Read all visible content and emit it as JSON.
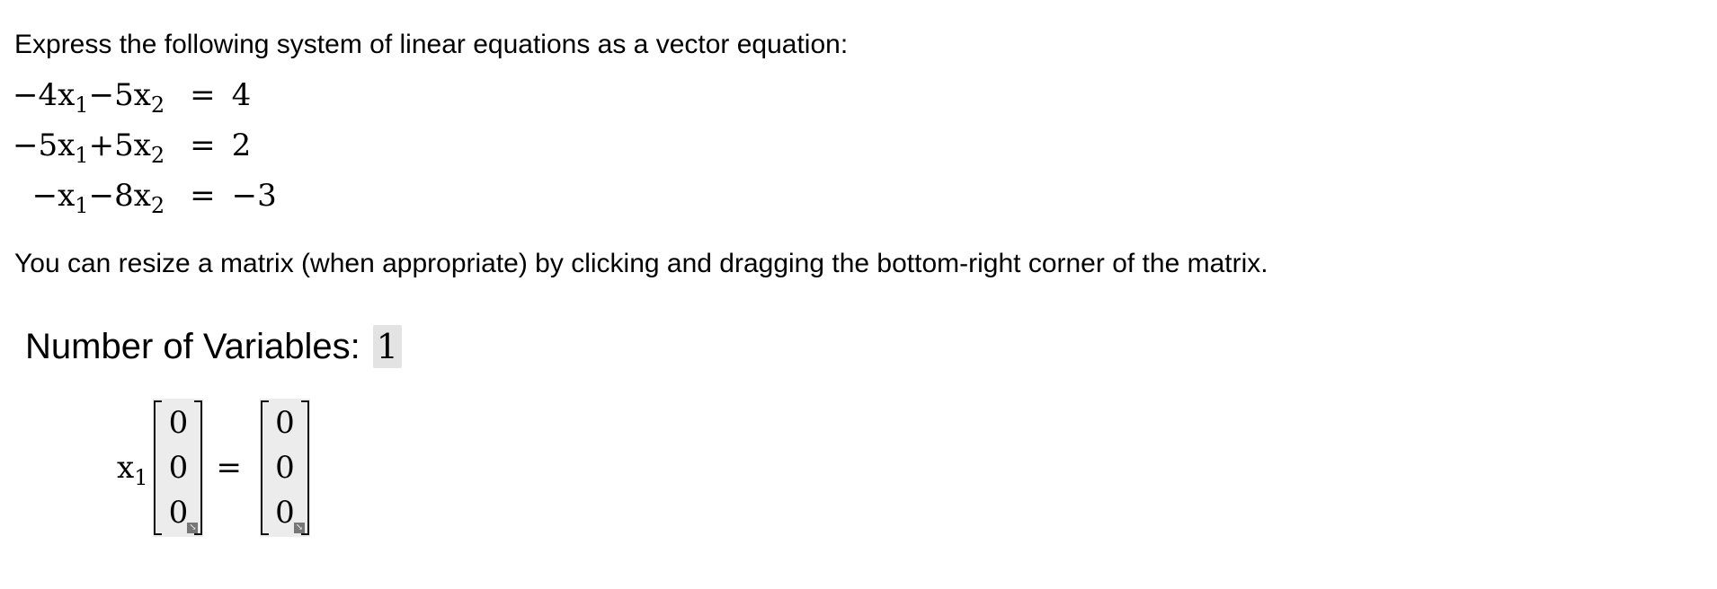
{
  "instructions": "Express the following system of linear equations as a vector equation:",
  "system": [
    {
      "terms": [
        {
          "text": "−4x",
          "sub": "1"
        },
        {
          "text": "−5x",
          "sub": "2"
        }
      ],
      "equals": "=",
      "rhs": "4"
    },
    {
      "terms": [
        {
          "text": "−5x",
          "sub": "1"
        },
        {
          "text": "+5x",
          "sub": "2"
        }
      ],
      "equals": "=",
      "rhs": "2"
    },
    {
      "terms": [
        {
          "text": "−x",
          "sub": "1"
        },
        {
          "text": "−8x",
          "sub": "2"
        }
      ],
      "equals": "=",
      "rhs": "−3"
    }
  ],
  "resize_hint": "You can resize a matrix (when appropriate) by clicking and dragging the bottom-right corner of the matrix.",
  "num_variables": {
    "label": "Number of Variables:",
    "value": "1"
  },
  "vector_equation": {
    "variable": {
      "base": "x",
      "sub": "1"
    },
    "coefficient_vector": [
      "0",
      "0",
      "0"
    ],
    "equals": "=",
    "constant_vector": [
      "0",
      "0",
      "0"
    ]
  }
}
